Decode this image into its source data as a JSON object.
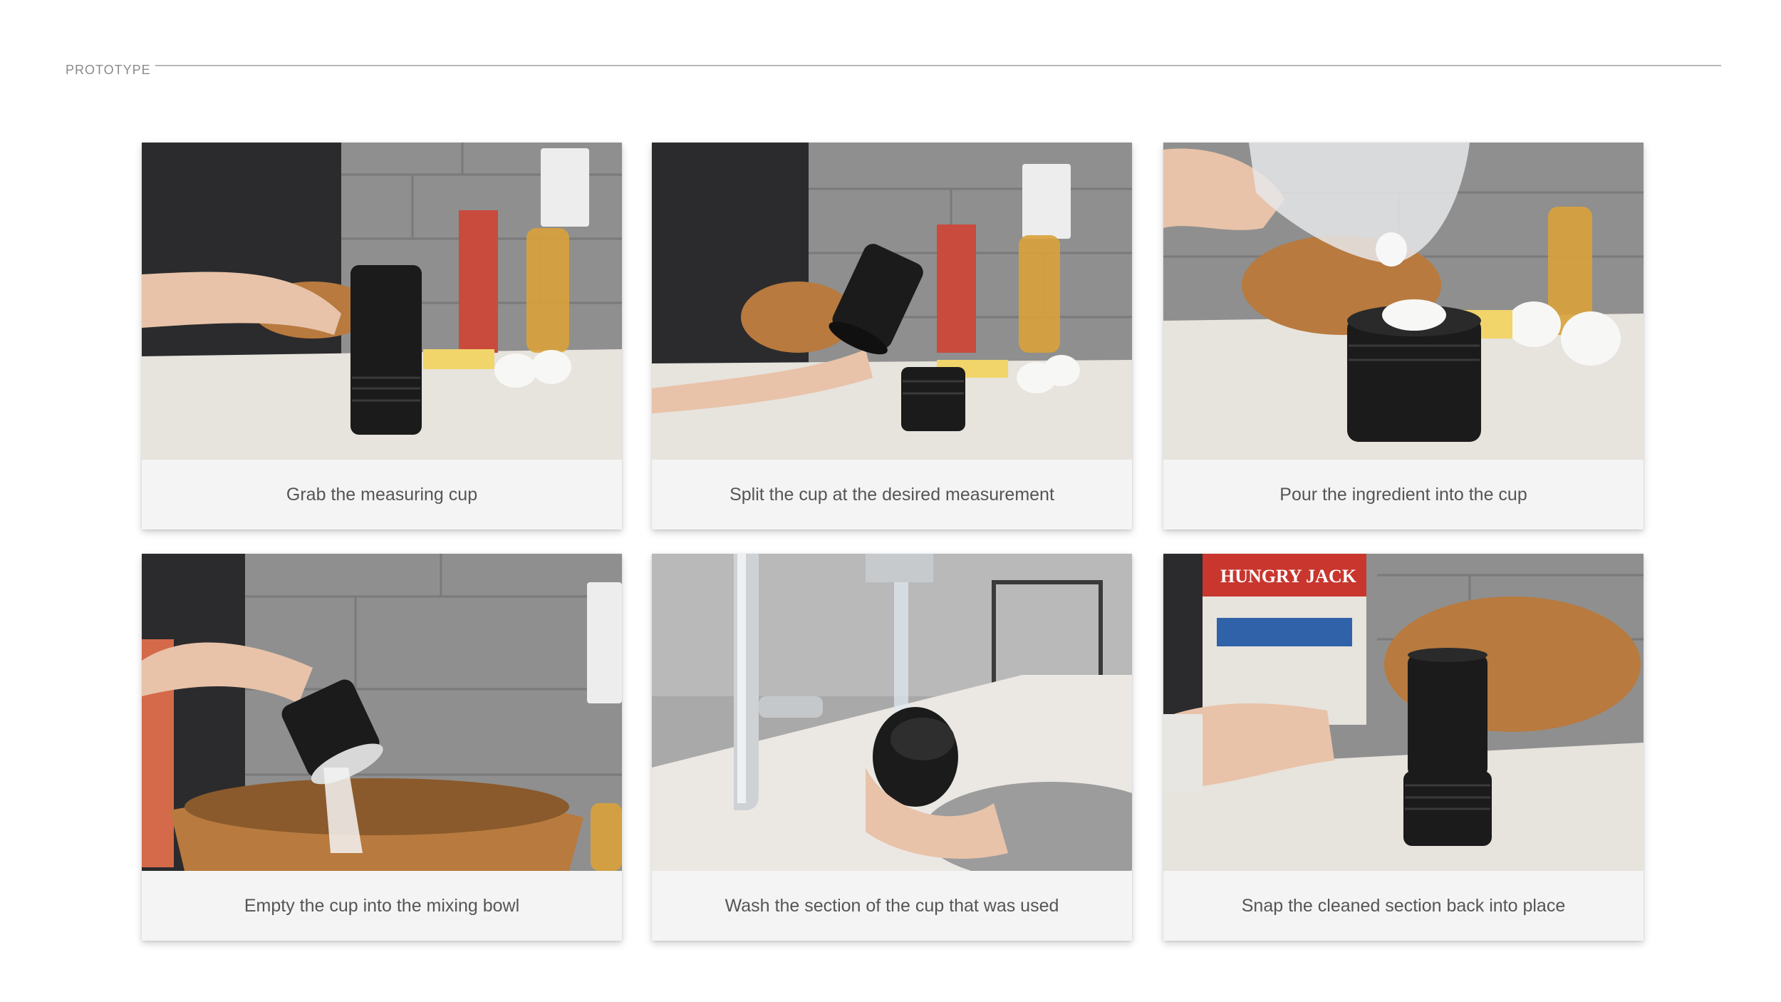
{
  "header": {
    "label": "PROTOTYPE"
  },
  "steps": [
    {
      "caption": "Grab the measuring cup",
      "photo_icon": "hand-holding-cup-photo"
    },
    {
      "caption": "Split the cup at the desired measurement",
      "photo_icon": "split-cup-photo"
    },
    {
      "caption": "Pour the ingredient into the cup",
      "photo_icon": "pour-flour-photo"
    },
    {
      "caption": "Empty the cup into the mixing bowl",
      "photo_icon": "empty-into-bowl-photo"
    },
    {
      "caption": "Wash the section of the cup that was used",
      "photo_icon": "wash-cup-photo"
    },
    {
      "caption": "Snap the cleaned section back into place",
      "photo_icon": "snap-cup-photo"
    }
  ],
  "photo_labels": {
    "pancake_box_brand": "HUNGRY JACK"
  },
  "colors": {
    "caption_bg": "#f4f4f4",
    "caption_text": "#555555",
    "cup": "#1b1b1b",
    "wall_tile": "#8d8d8d",
    "counter": "#e9e6e1",
    "wood_bowl": "#b87a3e"
  }
}
